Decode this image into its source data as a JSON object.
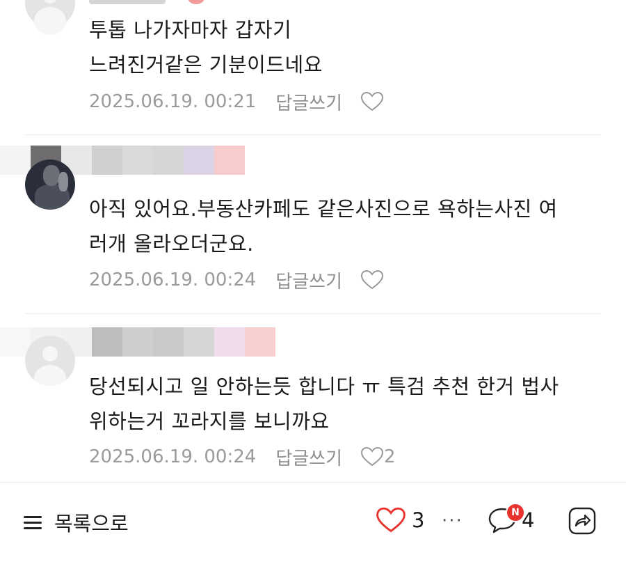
{
  "comments": [
    {
      "lines": [
        "투톱 나가자마자 갑자기",
        "느려진거같은 기분이드네요"
      ],
      "date": "2025.06.19. 00:21",
      "reply_label": "답글쓰기",
      "likes": ""
    },
    {
      "lines": [
        "아직 있어요.부동산카페도 같은사진으로 욕하는사진 여",
        "러개 올라오더군요."
      ],
      "date": "2025.06.19. 00:24",
      "reply_label": "답글쓰기",
      "likes": ""
    },
    {
      "lines": [
        "당선되시고 일 안하는듯 합니다 ㅠ 특검 추천 한거 법사",
        "위하는거 꼬라지를 보니까요"
      ],
      "date": "2025.06.19. 00:24",
      "reply_label": "답글쓰기",
      "likes": "2"
    }
  ],
  "bottom_bar": {
    "list_label": "목록으로",
    "like_count": "3",
    "more_label": "···",
    "comment_count": "4",
    "new_badge": "N"
  },
  "colors": {
    "like_heart": "#e8322d",
    "badge": "#e8322d",
    "meta_text": "#9a9a9a"
  },
  "icons": [
    "avatar-placeholder-icon",
    "heart-icon",
    "menu-icon",
    "heart-outline-icon",
    "speech-bubble-icon",
    "share-icon"
  ]
}
